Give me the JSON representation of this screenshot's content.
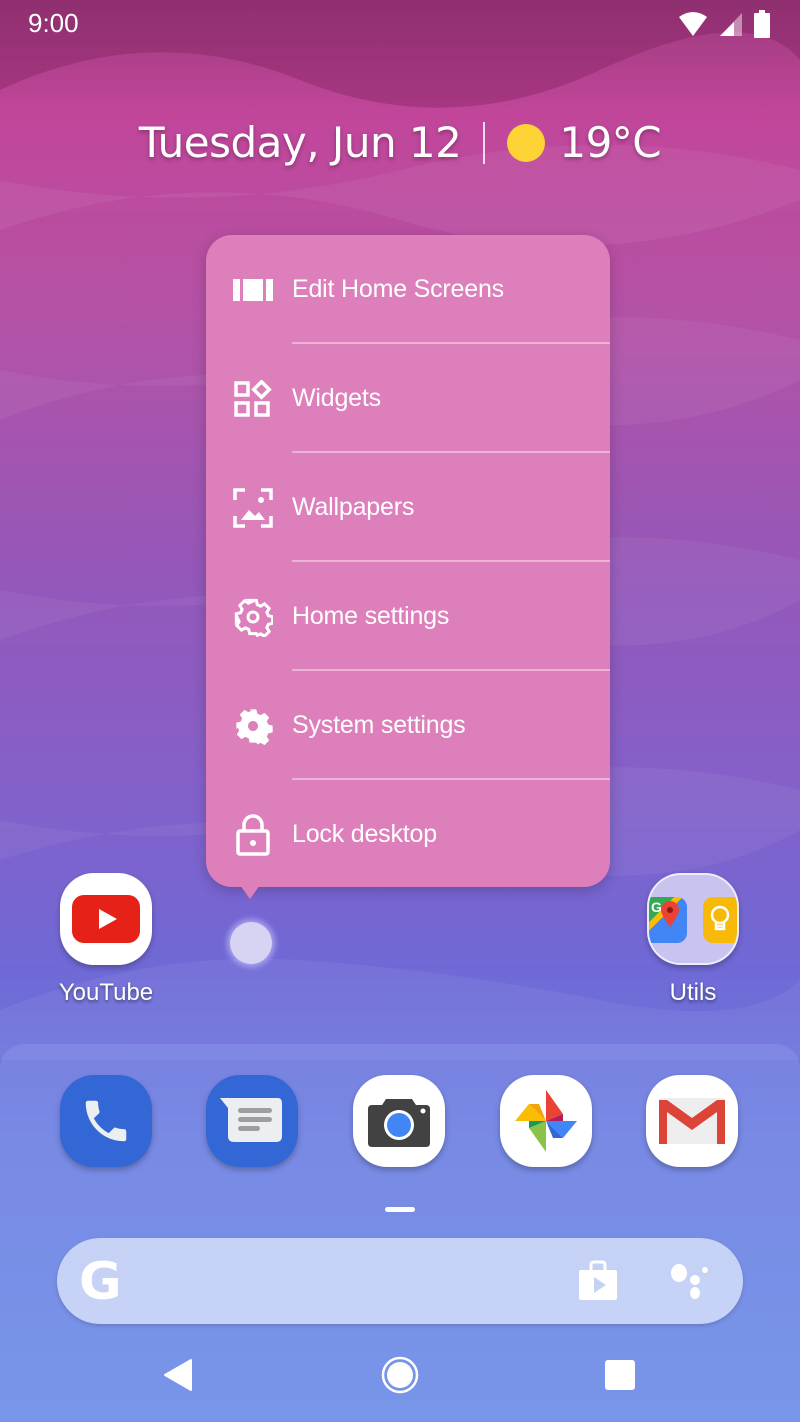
{
  "status_bar": {
    "time": "9:00",
    "icons": [
      "wifi-icon",
      "cell-signal-icon",
      "battery-icon"
    ]
  },
  "at_a_glance": {
    "date": "Tuesday, Jun 12",
    "weather_icon": "sun-icon",
    "temperature": "19°C",
    "sun_color": "#fdd335"
  },
  "popup_menu": {
    "background": "#dd7fba",
    "items": [
      {
        "label": "Edit Home Screens",
        "icon": "edit-screens-icon"
      },
      {
        "label": "Widgets",
        "icon": "widgets-icon"
      },
      {
        "label": "Wallpapers",
        "icon": "wallpaper-icon"
      },
      {
        "label": "Home settings",
        "icon": "gear-outline-icon"
      },
      {
        "label": "System settings",
        "icon": "gear-icon"
      },
      {
        "label": "Lock desktop",
        "icon": "lock-icon"
      }
    ]
  },
  "home_apps": [
    {
      "label": "YouTube",
      "icon": "youtube-icon"
    },
    {
      "label": "Utils",
      "icon": "folder-icon",
      "contents": [
        "maps-icon",
        "keep-icon"
      ]
    }
  ],
  "dock": {
    "apps": [
      {
        "name": "Phone",
        "icon": "phone-icon"
      },
      {
        "name": "Messages",
        "icon": "messages-icon"
      },
      {
        "name": "Camera",
        "icon": "camera-icon"
      },
      {
        "name": "Photos",
        "icon": "photos-icon"
      },
      {
        "name": "Gmail",
        "icon": "gmail-icon"
      }
    ]
  },
  "search_bar": {
    "logo": "G",
    "icons": [
      "play-store-icon",
      "assistant-icon"
    ]
  },
  "nav_bar": {
    "buttons": [
      "back-button",
      "home-button",
      "recents-button"
    ]
  }
}
